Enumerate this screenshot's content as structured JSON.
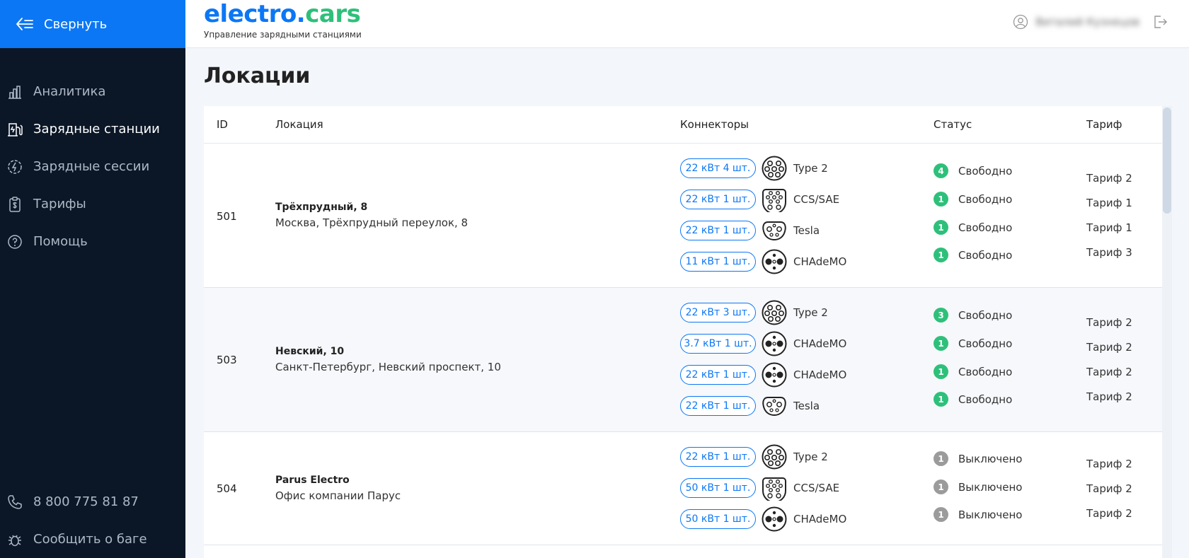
{
  "sidebar": {
    "collapse_label": "Свернуть",
    "items": [
      {
        "label": "Аналитика",
        "icon": "bar-chart-icon",
        "active": false
      },
      {
        "label": "Зарядные станции",
        "icon": "charging-station-icon",
        "active": true
      },
      {
        "label": "Зарядные сессии",
        "icon": "lightning-circle-icon",
        "active": false
      },
      {
        "label": "Тарифы",
        "icon": "clipboard-icon",
        "active": false
      },
      {
        "label": "Помощь",
        "icon": "help-icon",
        "active": false
      }
    ],
    "phone": "8 800 775 81 87",
    "report_bug": "Сообщить о баге"
  },
  "header": {
    "logo_part1": "electro.",
    "logo_part2": "cars",
    "subtitle": "Управление зарядными станциями",
    "user_name": "Виталий Кузнецов",
    "colors": {
      "primary": "#0b77f5",
      "accent": "#2ec07a",
      "sidebar": "#0b1727"
    }
  },
  "page": {
    "title": "Локации"
  },
  "table": {
    "headers": {
      "id": "ID",
      "location": "Локация",
      "connectors": "Коннекторы",
      "status": "Статус",
      "tariff": "Тариф"
    },
    "rows": [
      {
        "id": "501",
        "name": "Трёхпрудный, 8",
        "address": "Москва, Трёхпрудный переулок, 8",
        "connectors": [
          {
            "power": "22 кВт 4 шт.",
            "type": "Type 2",
            "icon": "type2-plug-icon"
          },
          {
            "power": "22 кВт 1 шт.",
            "type": "CCS/SAE",
            "icon": "ccs-plug-icon"
          },
          {
            "power": "22 кВт 1 шт.",
            "type": "Tesla",
            "icon": "tesla-plug-icon"
          },
          {
            "power": "11 кВт 1 шт.",
            "type": "CHAdeMO",
            "icon": "chademo-plug-icon"
          }
        ],
        "statuses": [
          {
            "count": "4",
            "text": "Свободно",
            "color": "green"
          },
          {
            "count": "1",
            "text": "Свободно",
            "color": "green"
          },
          {
            "count": "1",
            "text": "Свободно",
            "color": "green"
          },
          {
            "count": "1",
            "text": "Свободно",
            "color": "green"
          }
        ],
        "tariffs": [
          "Тариф 2",
          "Тариф 1",
          "Тариф 1",
          "Тариф 3"
        ]
      },
      {
        "id": "503",
        "name": "Невский, 10",
        "address": "Санкт-Петербург, Невский проспект, 10",
        "connectors": [
          {
            "power": "22 кВт 3 шт.",
            "type": "Type 2",
            "icon": "type2-plug-icon"
          },
          {
            "power": "3.7 кВт 1 шт.",
            "type": "CHAdeMO",
            "icon": "chademo-plug-icon"
          },
          {
            "power": "22 кВт 1 шт.",
            "type": "CHAdeMO",
            "icon": "chademo-plug-icon"
          },
          {
            "power": "22 кВт 1 шт.",
            "type": "Tesla",
            "icon": "tesla-plug-icon"
          }
        ],
        "statuses": [
          {
            "count": "3",
            "text": "Свободно",
            "color": "green"
          },
          {
            "count": "1",
            "text": "Свободно",
            "color": "green"
          },
          {
            "count": "1",
            "text": "Свободно",
            "color": "green"
          },
          {
            "count": "1",
            "text": "Свободно",
            "color": "green"
          }
        ],
        "tariffs": [
          "Тариф 2",
          "Тариф 2",
          "Тариф 2",
          "Тариф 2"
        ]
      },
      {
        "id": "504",
        "name": "Parus Electro",
        "address": "Офис компании Парус",
        "connectors": [
          {
            "power": "22 кВт 1 шт.",
            "type": "Type 2",
            "icon": "type2-plug-icon"
          },
          {
            "power": "50 кВт 1 шт.",
            "type": "CCS/SAE",
            "icon": "ccs-plug-icon"
          },
          {
            "power": "50 кВт 1 шт.",
            "type": "CHAdeMO",
            "icon": "chademo-plug-icon"
          }
        ],
        "statuses": [
          {
            "count": "1",
            "text": "Выключено",
            "color": "gray"
          },
          {
            "count": "1",
            "text": "Выключено",
            "color": "gray"
          },
          {
            "count": "1",
            "text": "Выключено",
            "color": "gray"
          }
        ],
        "tariffs": [
          "Тариф 2",
          "Тариф 2",
          "Тариф 2"
        ]
      }
    ]
  }
}
